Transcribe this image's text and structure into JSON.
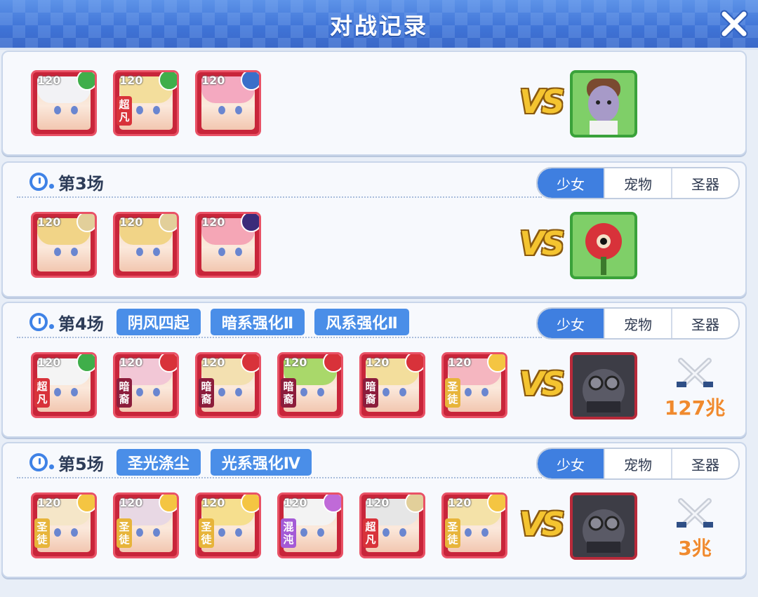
{
  "header": {
    "title": "对战记录"
  },
  "tabs": [
    "少女",
    "宠物",
    "圣器"
  ],
  "vs_text": "VS",
  "matches": [
    {
      "title": "",
      "buffs": [],
      "show_tabs": false,
      "heroes": [
        {
          "level": "120",
          "tag": "",
          "element": "wind",
          "hair": "#f2f2f5"
        },
        {
          "level": "120",
          "tag": "超凡",
          "element": "wind",
          "hair": "#f3de9c"
        },
        {
          "level": "120",
          "tag": "",
          "element": "holy",
          "hair": "#f4a9c0"
        }
      ],
      "enemy": {
        "type": "green",
        "name": "zombie-enemy"
      },
      "damage": ""
    },
    {
      "title": "第3场",
      "buffs": [],
      "show_tabs": true,
      "heroes": [
        {
          "level": "120",
          "tag": "",
          "element": "light",
          "hair": "#f1d487"
        },
        {
          "level": "120",
          "tag": "",
          "element": "light",
          "hair": "#f1d487"
        },
        {
          "level": "120",
          "tag": "",
          "element": "dark",
          "hair": "#f5a6b6"
        }
      ],
      "enemy": {
        "type": "green",
        "name": "flower-enemy"
      },
      "damage": ""
    },
    {
      "title": "第4场",
      "buffs": [
        "阴风四起",
        "暗系强化Ⅱ",
        "风系强化Ⅱ"
      ],
      "show_tabs": true,
      "heroes": [
        {
          "level": "120",
          "tag": "超凡",
          "element": "wind",
          "hair": "#f4f4f4"
        },
        {
          "level": "120",
          "tag": "暗裔",
          "element": "fire",
          "hair": "#f2c7d6"
        },
        {
          "level": "120",
          "tag": "暗裔",
          "element": "fire",
          "hair": "#f3e0b0"
        },
        {
          "level": "120",
          "tag": "暗裔",
          "element": "fire",
          "hair": "#a9d86a"
        },
        {
          "level": "120",
          "tag": "暗裔",
          "element": "fire",
          "hair": "#f3de9c"
        },
        {
          "level": "120",
          "tag": "圣徒",
          "element": "star",
          "hair": "#f5b6c0"
        }
      ],
      "enemy": {
        "type": "boss",
        "name": "boss-enemy"
      },
      "damage": "127兆"
    },
    {
      "title": "第5场",
      "buffs": [
        "圣光涤尘",
        "光系强化Ⅳ"
      ],
      "show_tabs": true,
      "heroes": [
        {
          "level": "120",
          "tag": "圣徒",
          "element": "star",
          "hair": "#f5e6c8"
        },
        {
          "level": "120",
          "tag": "圣徒",
          "element": "star",
          "hair": "#e8d8e4"
        },
        {
          "level": "120",
          "tag": "圣徒",
          "element": "star",
          "hair": "#f6df8e"
        },
        {
          "level": "120",
          "tag": "混沌",
          "element": "chaos",
          "hair": "#f3f3f3"
        },
        {
          "level": "120",
          "tag": "超凡",
          "element": "light",
          "hair": "#e6e6e6"
        },
        {
          "level": "120",
          "tag": "圣徒",
          "element": "star",
          "hair": "#f4e2a8"
        }
      ],
      "enemy": {
        "type": "boss",
        "name": "boss-enemy"
      },
      "damage": "3兆"
    }
  ]
}
